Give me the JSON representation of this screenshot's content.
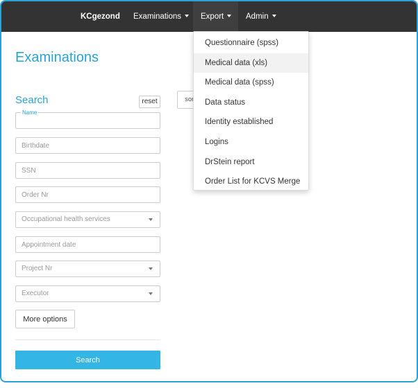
{
  "navbar": {
    "brand": "KCgezond",
    "items": [
      {
        "label": "Examinations"
      },
      {
        "label": "Export"
      },
      {
        "label": "Admin"
      }
    ]
  },
  "export_menu": {
    "items": [
      {
        "label": "Questionnaire (spss)"
      },
      {
        "label": "Medical data (xls)"
      },
      {
        "label": "Medical data (spss)"
      },
      {
        "label": "Data status"
      },
      {
        "label": "Identity established"
      },
      {
        "label": "Logins"
      },
      {
        "label": "DrStein report"
      },
      {
        "label": "Order List for KCVS Merge"
      }
    ]
  },
  "page": {
    "title": "Examinations"
  },
  "search": {
    "title": "Search",
    "reset_label": "reset",
    "sort_label": "sort",
    "name_label": "Name",
    "birthdate_placeholder": "Birthdate",
    "ssn_placeholder": "SSN",
    "order_placeholder": "Order Nr",
    "occupational_selected": "Occupational health services",
    "appointment_placeholder": "Appointment date",
    "project_selected": "Project Nr",
    "executor_selected": "Executor",
    "more_options_label": "More options",
    "search_label": "Search"
  },
  "colors": {
    "accent": "#29a3d6",
    "navbar": "#333333",
    "primary_button": "#33b5e5"
  }
}
